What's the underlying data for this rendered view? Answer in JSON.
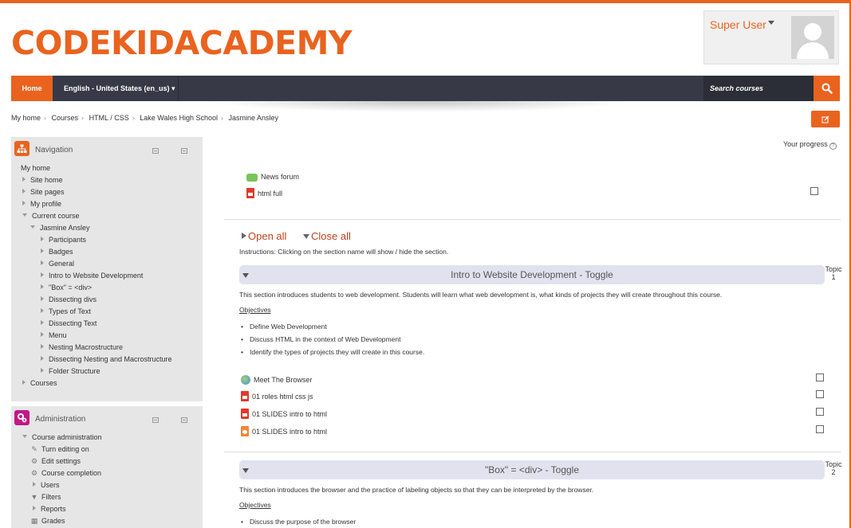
{
  "site": {
    "name": "CODEKIDACADEMY"
  },
  "user": {
    "name": "Super User"
  },
  "navbar": {
    "home_label": "Home",
    "language_label": "English - United States (en_us) ▾",
    "search_placeholder": "Search courses"
  },
  "breadcrumb": [
    "My home",
    "Courses",
    "HTML / CSS",
    "Lake Wales High School",
    "Jasmine Ansley"
  ],
  "navigation_block": {
    "title": "Navigation",
    "items": {
      "my_home": "My home",
      "site_home": "Site home",
      "site_pages": "Site pages",
      "my_profile": "My profile",
      "current_course": "Current course",
      "jasmine_ansley": "Jasmine Ansley",
      "participants": "Participants",
      "badges": "Badges",
      "general": "General",
      "intro": "Intro to Website Development",
      "box_div": "\"Box\" = <div>",
      "dissecting_divs": "Dissecting divs",
      "types_of_text": "Types of Text",
      "dissecting_text": "Dissecting Text",
      "menu": "Menu",
      "nesting_macro": "Nesting Macrostructure",
      "dissecting_nesting": "Dissecting Nesting and Macrostructure",
      "folder_structure": "Folder Structure",
      "courses": "Courses"
    }
  },
  "administration_block": {
    "title": "Administration",
    "items": {
      "course_admin": "Course administration",
      "turn_editing": "Turn editing on",
      "edit_settings": "Edit settings",
      "course_completion": "Course completion",
      "users": "Users",
      "filters": "Filters",
      "reports": "Reports",
      "grades": "Grades"
    }
  },
  "progress": {
    "label": "Your progress"
  },
  "top_modules": {
    "news_forum": "News forum",
    "html_full": "html full"
  },
  "toggles": {
    "open_all": "Open all",
    "close_all": "Close all",
    "instructions": "Instructions: Clicking on the section name will show / hide the section."
  },
  "sections": [
    {
      "title": "Intro to Website Development - Toggle",
      "topic_word": "Topic",
      "topic_number": "1",
      "summary": "This section introduces students to web development.  Students will learn what web development is, what kinds of projects they will create throughout this course.",
      "objectives_label": "Objectives",
      "objectives": [
        "Define Web Development",
        "Discuss HTML in the context of Web Development",
        "Identify the types of projects they will create in this course."
      ],
      "activities": [
        "Meet The Browser",
        "01 roles html css js",
        "01 SLIDES intro to html",
        "01 SLIDES intro to html"
      ]
    },
    {
      "title": "\"Box\" = <div> - Toggle",
      "topic_word": "Topic",
      "topic_number": "2",
      "summary": "This section introduces  the browser and the practice of labeling objects so that they can be interpreted by the browser.",
      "objectives_label": "Objectives",
      "objectives": [
        "Discuss the purpose of the browser"
      ]
    }
  ],
  "colors": {
    "accent": "#e9631f",
    "navbar": "#373a46",
    "section_bar": "#e2e2ef",
    "link": "#b8421c"
  }
}
